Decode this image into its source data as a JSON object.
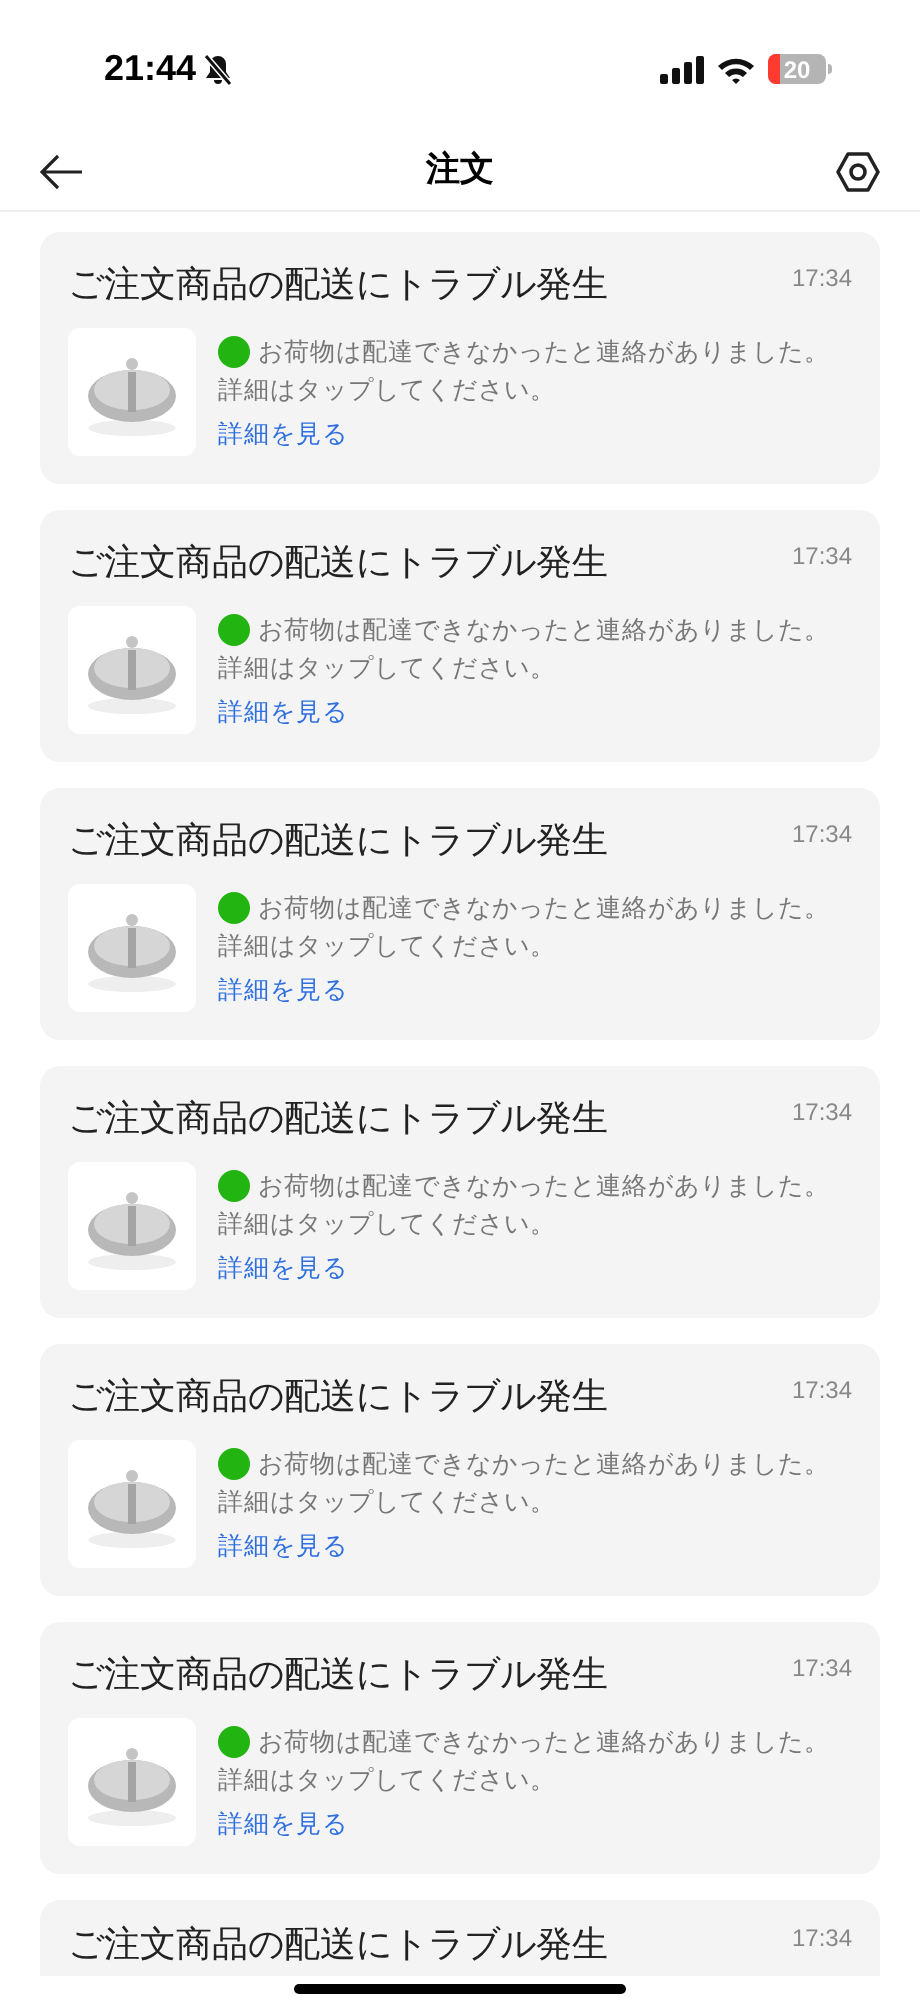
{
  "status_bar": {
    "time": "21:44",
    "battery": "20"
  },
  "header": {
    "title": "注文"
  },
  "notifications": [
    {
      "title": "ご注文商品の配送にトラブル発生",
      "time": "17:34",
      "message": "お荷物は配達できなかったと連絡がありました。",
      "hint": "詳細はタップしてください。",
      "link": "詳細を見る"
    },
    {
      "title": "ご注文商品の配送にトラブル発生",
      "time": "17:34",
      "message": "お荷物は配達できなかったと連絡がありました。",
      "hint": "詳細はタップしてください。",
      "link": "詳細を見る"
    },
    {
      "title": "ご注文商品の配送にトラブル発生",
      "time": "17:34",
      "message": "お荷物は配達できなかったと連絡がありました。",
      "hint": "詳細はタップしてください。",
      "link": "詳細を見る"
    },
    {
      "title": "ご注文商品の配送にトラブル発生",
      "time": "17:34",
      "message": "お荷物は配達できなかったと連絡がありました。",
      "hint": "詳細はタップしてください。",
      "link": "詳細を見る"
    },
    {
      "title": "ご注文商品の配送にトラブル発生",
      "time": "17:34",
      "message": "お荷物は配達できなかったと連絡がありました。",
      "hint": "詳細はタップしてください。",
      "link": "詳細を見る"
    },
    {
      "title": "ご注文商品の配送にトラブル発生",
      "time": "17:34",
      "message": "お荷物は配達できなかったと連絡がありました。",
      "hint": "詳細はタップしてください。",
      "link": "詳細を見る"
    },
    {
      "title": "ご注文商品の配送にトラブル発生",
      "time": "17:34"
    }
  ]
}
